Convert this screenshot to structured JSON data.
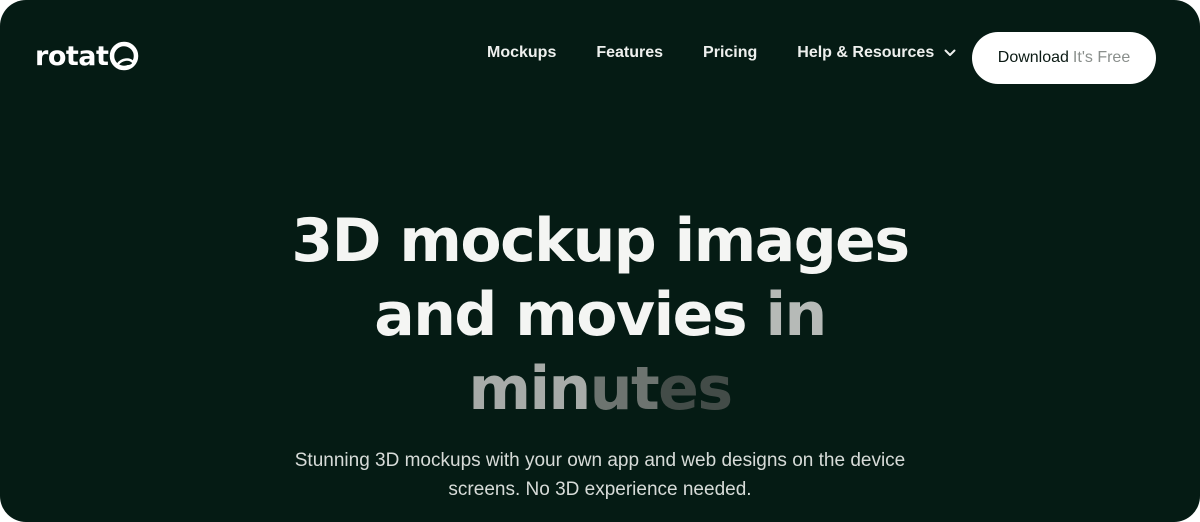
{
  "brand": {
    "name": "rotat"
  },
  "nav": {
    "items": [
      {
        "label": "Mockups"
      },
      {
        "label": "Features"
      },
      {
        "label": "Pricing"
      },
      {
        "label": "Help & Resources",
        "icon": "chevron-down-icon"
      }
    ]
  },
  "cta": {
    "label": "Download",
    "sublabel": "It's Free"
  },
  "hero": {
    "line1": "3D mockup images",
    "line2_main": "and movies",
    "line2_fade": "in",
    "line3_a": "min",
    "line3_b": "u",
    "line3_c": "t",
    "line3_d": "es",
    "subtitle_line1": "Stunning 3D mockups with your own app and web designs on the device",
    "subtitle_line2": "screens. No 3D experience needed."
  },
  "colors": {
    "background": "#051b14",
    "text": "#f4f5f3",
    "cta_background": "#ffffff",
    "cta_muted": "#8a8f8c"
  }
}
